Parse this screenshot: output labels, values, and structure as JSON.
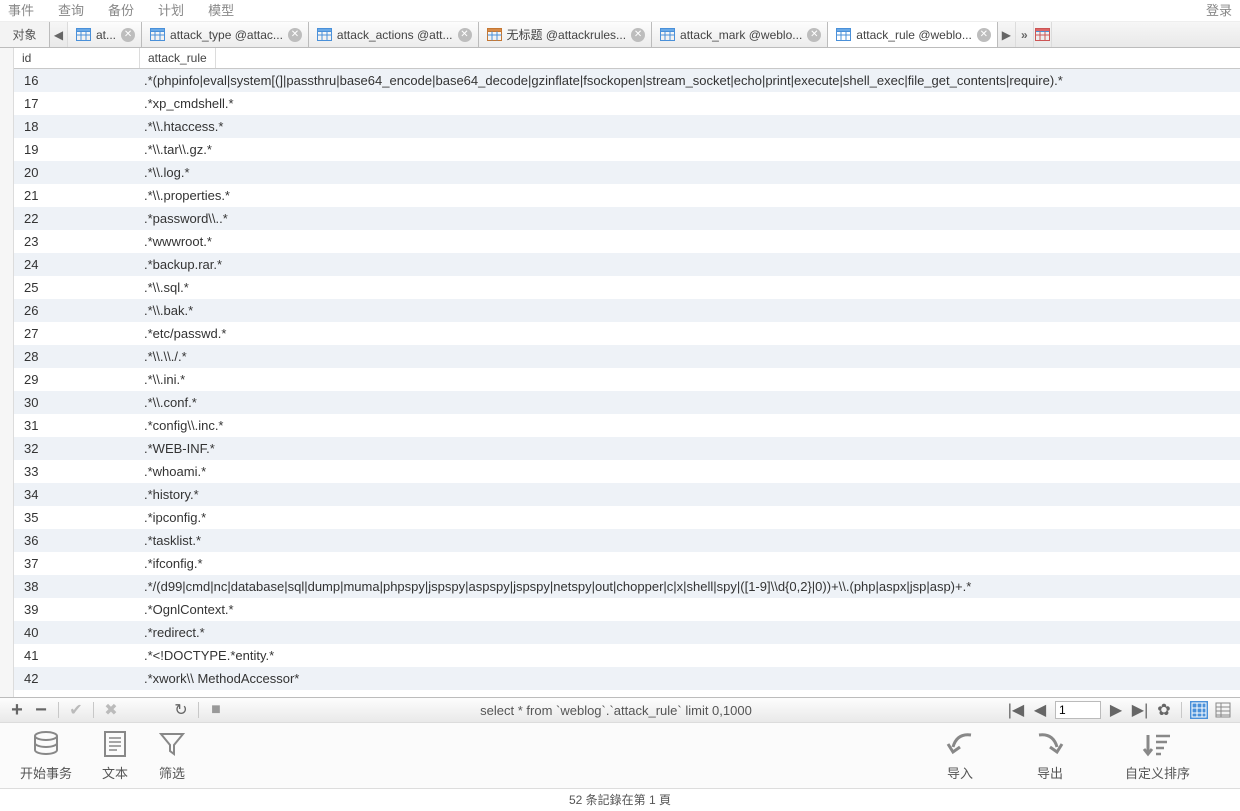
{
  "menu": {
    "items": [
      "事件",
      "查询",
      "备份",
      "计划",
      "模型"
    ],
    "login": "登录"
  },
  "tabs": {
    "side": "对象",
    "list": [
      {
        "label": "at..."
      },
      {
        "label": "attack_type @attac..."
      },
      {
        "label": "attack_actions @att..."
      },
      {
        "label": "无标题 @attackrules...",
        "q": true
      },
      {
        "label": "attack_mark @weblo..."
      },
      {
        "label": "attack_rule @weblo...",
        "active": true
      }
    ]
  },
  "columns": {
    "id": "id",
    "rule": "attack_rule"
  },
  "rows": [
    {
      "id": "16",
      "rule": ".*(phpinfo|eval|system[(]|passthru|base64_encode|base64_decode|gzinflate|fsockopen|stream_socket|echo|print|execute|shell_exec|file_get_contents|require).*"
    },
    {
      "id": "17",
      "rule": ".*xp_cmdshell.*"
    },
    {
      "id": "18",
      "rule": ".*\\\\.htaccess.*"
    },
    {
      "id": "19",
      "rule": ".*\\\\.tar\\\\.gz.*"
    },
    {
      "id": "20",
      "rule": ".*\\\\.log.*"
    },
    {
      "id": "21",
      "rule": ".*\\\\.properties.*"
    },
    {
      "id": "22",
      "rule": ".*password\\\\..*"
    },
    {
      "id": "23",
      "rule": ".*wwwroot.*"
    },
    {
      "id": "24",
      "rule": ".*backup.rar.*"
    },
    {
      "id": "25",
      "rule": ".*\\\\.sql.*"
    },
    {
      "id": "26",
      "rule": ".*\\\\.bak.*"
    },
    {
      "id": "27",
      "rule": ".*etc/passwd.*"
    },
    {
      "id": "28",
      "rule": ".*\\\\.\\\\./.*"
    },
    {
      "id": "29",
      "rule": ".*\\\\.ini.*"
    },
    {
      "id": "30",
      "rule": ".*\\\\.conf.*"
    },
    {
      "id": "31",
      "rule": ".*config\\\\.inc.*"
    },
    {
      "id": "32",
      "rule": ".*WEB-INF.*"
    },
    {
      "id": "33",
      "rule": ".*whoami.*"
    },
    {
      "id": "34",
      "rule": ".*history.*"
    },
    {
      "id": "35",
      "rule": ".*ipconfig.*"
    },
    {
      "id": "36",
      "rule": ".*tasklist.*"
    },
    {
      "id": "37",
      "rule": ".*ifconfig.*"
    },
    {
      "id": "38",
      "rule": ".*/(d99|cmd|nc|database|sql|dump|muma|phpspy|jspspy|aspspy|jspspy|netspy|out|chopper|c|x|shell|spy|([1-9]\\\\d{0,2}|0))+\\\\.(php|aspx|jsp|asp)+.*"
    },
    {
      "id": "39",
      "rule": ".*OgnlContext.*"
    },
    {
      "id": "40",
      "rule": ".*redirect.*"
    },
    {
      "id": "41",
      "rule": ".*<!DOCTYPE.*entity.*"
    },
    {
      "id": "42",
      "rule": ".*xwork\\\\ MethodAccessor*"
    }
  ],
  "footer": {
    "sql": "select * from `weblog`.`attack_rule`  limit 0,1000",
    "page": "1"
  },
  "tools": {
    "begin": "开始事务",
    "text": "文本",
    "filter": "筛选",
    "import": "导入",
    "export": "导出",
    "sort": "自定义排序"
  },
  "status": "52 条記錄在第 1 頁"
}
